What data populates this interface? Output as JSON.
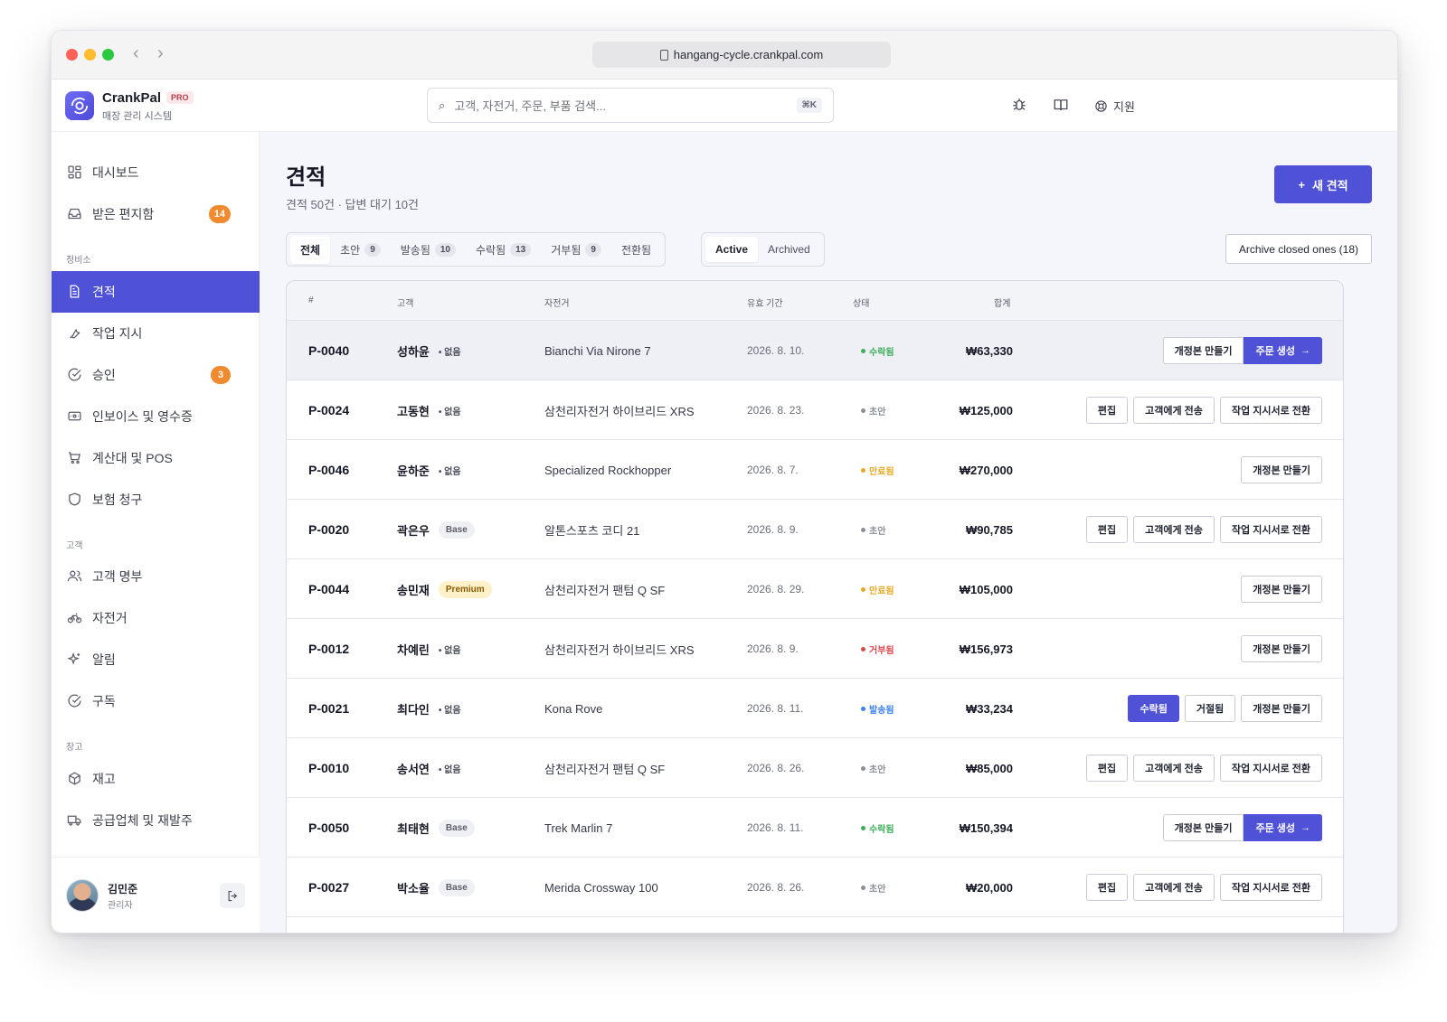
{
  "browser": {
    "url": "hangang-cycle.crankpal.com"
  },
  "brand": {
    "name": "CrankPal",
    "badge": "PRO",
    "subtitle": "매장 관리 시스템"
  },
  "header": {
    "search_placeholder": "고객, 자전거, 주문, 부품 검색...",
    "search_shortcut": "⌘K",
    "support_label": "지원"
  },
  "sidebar": {
    "items": [
      {
        "label": "대시보드",
        "icon": "dashboard-icon"
      },
      {
        "label": "받은 편지함",
        "icon": "inbox-icon",
        "badge": "14"
      },
      {
        "label": "견적",
        "icon": "document-icon",
        "active": true
      },
      {
        "label": "작업 지시",
        "icon": "wrench-icon"
      },
      {
        "label": "승인",
        "icon": "check-circle-icon",
        "badge": "3"
      },
      {
        "label": "인보이스 및 영수증",
        "icon": "receipt-icon"
      },
      {
        "label": "계산대 및 POS",
        "icon": "cart-icon"
      },
      {
        "label": "보험 청구",
        "icon": "shield-icon"
      },
      {
        "label": "고객 명부",
        "icon": "users-icon"
      },
      {
        "label": "자전거",
        "icon": "bicycle-icon"
      },
      {
        "label": "알림",
        "icon": "sparkle-icon"
      },
      {
        "label": "구독",
        "icon": "check-circle-icon"
      },
      {
        "label": "재고",
        "icon": "box-icon"
      },
      {
        "label": "공급업체 및 재발주",
        "icon": "truck-icon"
      }
    ],
    "sections": [
      "정비소",
      "고객",
      "창고"
    ],
    "user": {
      "name": "김민준",
      "role": "관리자"
    }
  },
  "page": {
    "title": "견적",
    "subtitle": "견적 50건 · 답변 대기 10건",
    "new_button": "새 견적",
    "tabs": [
      {
        "label": "전체",
        "count": ""
      },
      {
        "label": "초안",
        "count": "9"
      },
      {
        "label": "발송됨",
        "count": "10"
      },
      {
        "label": "수락됨",
        "count": "13"
      },
      {
        "label": "거부됨",
        "count": "9"
      },
      {
        "label": "전환됨",
        "count": ""
      }
    ],
    "segment": {
      "active": "Active",
      "archived": "Archived"
    },
    "archive_button": "Archive closed ones (18)"
  },
  "table": {
    "columns": {
      "id": "#",
      "customer": "고객",
      "bike": "자전거",
      "valid": "유효 기간",
      "status": "상태",
      "total": "합계"
    },
    "rows": [
      {
        "id": "P-0040",
        "customer": "성하윤",
        "tier": "없음",
        "tier_type": "none",
        "bike": "Bianchi Via Nirone 7",
        "date": "2026. 8. 10.",
        "status": "수락됨",
        "status_color": "#3fae5c",
        "total": "₩63,330",
        "actions": [
          "개정본 만들기",
          "주문 생성"
        ],
        "action_type": "accepted"
      },
      {
        "id": "P-0024",
        "customer": "고동현",
        "tier": "없음",
        "tier_type": "none",
        "bike": "삼천리자전거 하이브리드 XRS",
        "date": "2026. 8. 23.",
        "status": "초안",
        "status_color": "#8a8e99",
        "total": "₩125,000",
        "actions": [
          "편집",
          "고객에게 전송",
          "작업 지시서로 전환"
        ],
        "action_type": "draft"
      },
      {
        "id": "P-0046",
        "customer": "윤하준",
        "tier": "없음",
        "tier_type": "none",
        "bike": "Specialized Rockhopper",
        "date": "2026. 8. 7.",
        "status": "만료됨",
        "status_color": "#e8a928",
        "total": "₩270,000",
        "actions": [
          "개정본 만들기"
        ],
        "action_type": "single"
      },
      {
        "id": "P-0020",
        "customer": "곽은우",
        "tier": "Base",
        "tier_type": "base",
        "bike": "알톤스포츠 코디 21",
        "date": "2026. 8. 9.",
        "status": "초안",
        "status_color": "#8a8e99",
        "total": "₩90,785",
        "actions": [
          "편집",
          "고객에게 전송",
          "작업 지시서로 전환"
        ],
        "action_type": "draft"
      },
      {
        "id": "P-0044",
        "customer": "송민재",
        "tier": "Premium",
        "tier_type": "premium",
        "bike": "삼천리자전거 팬텀 Q SF",
        "date": "2026. 8. 29.",
        "status": "만료됨",
        "status_color": "#e8a928",
        "total": "₩105,000",
        "actions": [
          "개정본 만들기"
        ],
        "action_type": "single"
      },
      {
        "id": "P-0012",
        "customer": "차예린",
        "tier": "없음",
        "tier_type": "none",
        "bike": "삼천리자전거 하이브리드 XRS",
        "date": "2026. 8. 9.",
        "status": "거부됨",
        "status_color": "#e0474c",
        "total": "₩156,973",
        "actions": [
          "개정본 만들기"
        ],
        "action_type": "single"
      },
      {
        "id": "P-0021",
        "customer": "최다인",
        "tier": "없음",
        "tier_type": "none",
        "bike": "Kona Rove",
        "date": "2026. 8. 11.",
        "status": "발송됨",
        "status_color": "#3b82f6",
        "total": "₩33,234",
        "actions": [
          "수락됨",
          "거절됨",
          "개정본 만들기"
        ],
        "action_type": "sent"
      },
      {
        "id": "P-0010",
        "customer": "송서연",
        "tier": "없음",
        "tier_type": "none",
        "bike": "삼천리자전거 팬텀 Q SF",
        "date": "2026. 8. 26.",
        "status": "초안",
        "status_color": "#8a8e99",
        "total": "₩85,000",
        "actions": [
          "편집",
          "고객에게 전송",
          "작업 지시서로 전환"
        ],
        "action_type": "draft"
      },
      {
        "id": "P-0050",
        "customer": "최태현",
        "tier": "Base",
        "tier_type": "base",
        "bike": "Trek Marlin 7",
        "date": "2026. 8. 11.",
        "status": "수락됨",
        "status_color": "#3fae5c",
        "total": "₩150,394",
        "actions": [
          "개정본 만들기",
          "주문 생성"
        ],
        "action_type": "accepted"
      },
      {
        "id": "P-0027",
        "customer": "박소율",
        "tier": "Base",
        "tier_type": "base",
        "bike": "Merida Crossway 100",
        "date": "2026. 8. 26.",
        "status": "초안",
        "status_color": "#8a8e99",
        "total": "₩20,000",
        "actions": [
          "편집",
          "고객에게 전송",
          "작업 지시서로 전환"
        ],
        "action_type": "draft"
      }
    ]
  },
  "colors": {
    "accent": "#4f51d6",
    "badge": "#f08a2e",
    "background": "#f4f6fb"
  }
}
